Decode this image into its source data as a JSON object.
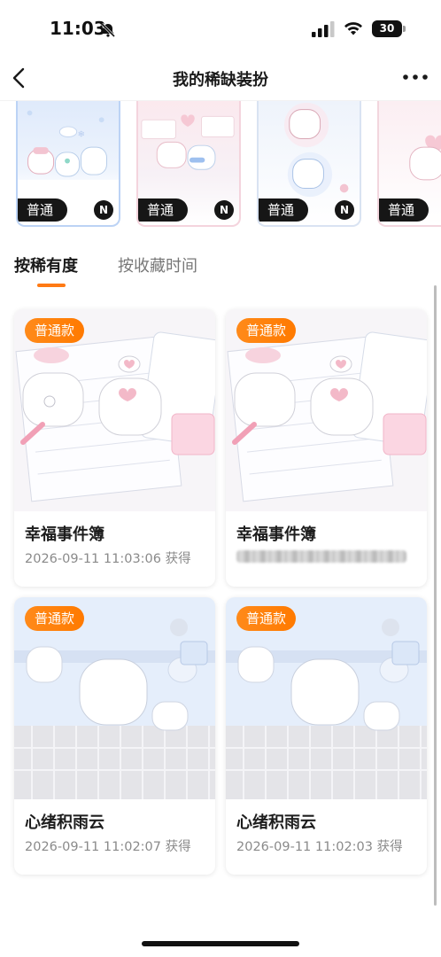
{
  "status_bar": {
    "time": "11:03",
    "battery": "30"
  },
  "nav": {
    "title": "我的稀缺装扮"
  },
  "carousel": [
    {
      "badge": "普通",
      "brand_icon": "N"
    },
    {
      "badge": "普通",
      "brand_icon": "N"
    },
    {
      "badge": "普通",
      "brand_icon": "N"
    },
    {
      "badge": "普通"
    }
  ],
  "tabs": {
    "rarity": "按稀有度",
    "collect_time": "按收藏时间",
    "active": "rarity"
  },
  "cards": [
    {
      "badge": "普通款",
      "title": "幸福事件簿",
      "date": "2026-09-11 11:03:06 获得"
    },
    {
      "badge": "普通款",
      "title": "幸福事件簿",
      "date_redacted": true
    },
    {
      "badge": "普通款",
      "title": "心绪积雨云",
      "date": "2026-09-11 11:02:07 获得"
    },
    {
      "badge": "普通款",
      "title": "心绪积雨云",
      "date": "2026-09-11 11:02:03 获得"
    }
  ],
  "colors": {
    "accent": "#ff7a14",
    "badge_bg": "#161616"
  }
}
